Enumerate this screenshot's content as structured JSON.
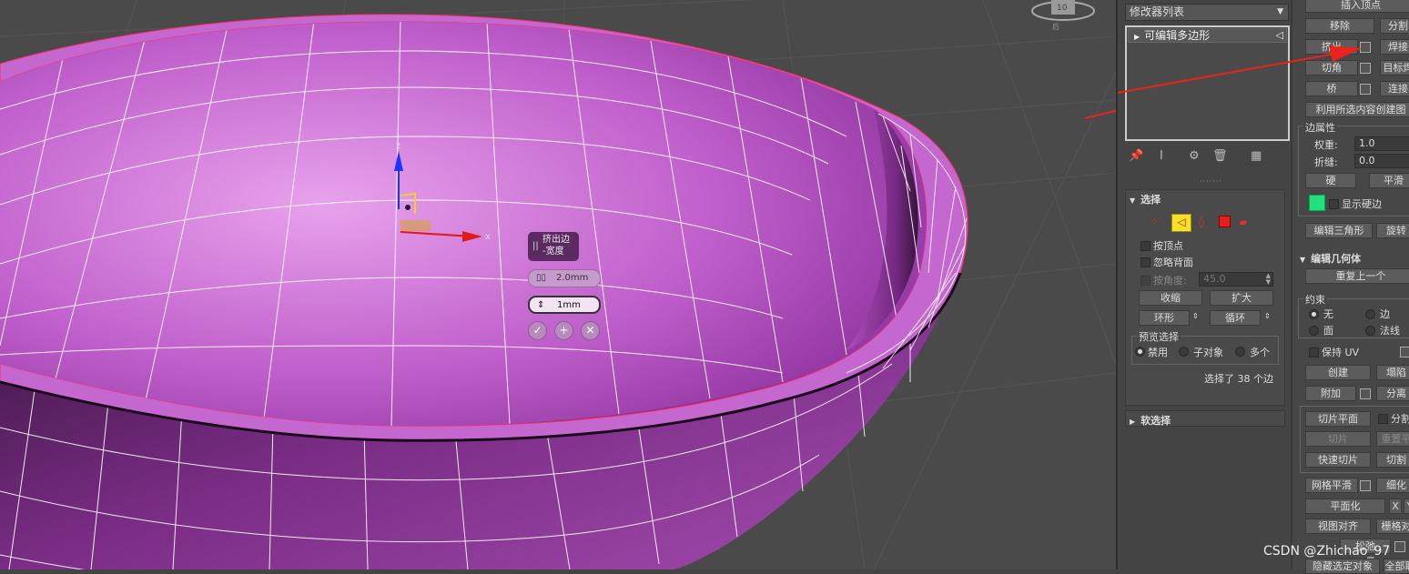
{
  "viewport": {
    "viewcube_label": "后",
    "caddy": {
      "title_line1": "挤出边",
      "title_line2": "-宽度",
      "field1_value": "2.0mm",
      "field2_value": "1mm",
      "ok_label": "✓",
      "apply_label": "+",
      "cancel_label": "✕"
    }
  },
  "modifier_panel": {
    "modifier_list_label": "修改器列表",
    "stack_items": [
      {
        "label": "可编辑多边形"
      }
    ]
  },
  "selection_rollout": {
    "title": "选择",
    "by_vertex": "按顶点",
    "ignore_backfacing": "忽略背面",
    "by_angle": "按角度:",
    "angle_value": "45.0",
    "shrink": "收缩",
    "grow": "扩大",
    "ring": "环形",
    "loop": "循环",
    "preview_title": "预览选择",
    "preview_disabled": "禁用",
    "preview_subobject": "子对象",
    "preview_multi": "多个",
    "status": "选择了 38 个边"
  },
  "soft_selection_rollout": {
    "title": "软选择"
  },
  "edit_edges": {
    "insert_vertex": "插入顶点",
    "remove": "移除",
    "split": "分割",
    "extrude": "挤出",
    "weld": "焊接",
    "chamfer": "切角",
    "target_weld": "目标焊",
    "bridge": "桥",
    "connect": "连接",
    "create_shape": "利用所选内容创建图",
    "edge_props": "边属性",
    "weight_label": "权重:",
    "weight_value": "1.0",
    "crease_label": "折缝:",
    "crease_value": "0.0",
    "hard": "硬",
    "smooth": "平滑",
    "show_hard_edges": "显示硬边",
    "edit_tri": "编辑三角形",
    "turn": "旋转"
  },
  "edit_geometry": {
    "title": "编辑几何体",
    "repeat_last": "重复上一个",
    "constraints": "约束",
    "c_none": "无",
    "c_edge": "边",
    "c_face": "面",
    "c_normal": "法线",
    "preserve_uv": "保持 UV",
    "create": "创建",
    "collapse": "塌陷",
    "attach": "附加",
    "detach": "分离",
    "slice_plane": "切片平面",
    "split": "分割",
    "slice": "切片",
    "reset_plane": "重置平",
    "quick_slice": "快速切片",
    "cut": "切割",
    "mesh_smooth": "网格平滑",
    "tessellate": "细化",
    "make_planar": "平面化",
    "x_label": "X",
    "y_label": "Y",
    "view_align": "视图对齐",
    "grid_align": "栅格对",
    "relax": "松弛",
    "hide_selected": "隐藏选定对象",
    "unhide_all": "全部取"
  },
  "watermark": "CSDN @Zhichao_97",
  "colors": {
    "mesh": "#b04fbf",
    "mesh_highlight": "#e49ce9",
    "hard_edge_swatch": "#22e07a",
    "arrow": "#e8241c",
    "selected_icon_bg": "#f5e02a"
  }
}
